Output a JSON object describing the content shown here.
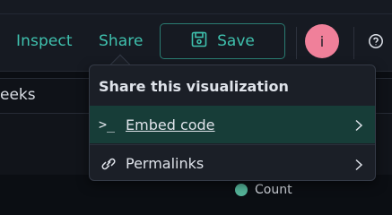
{
  "header": {
    "inspect_label": "Inspect",
    "share_label": "Share",
    "save_label": "Save",
    "avatar_initial": "i"
  },
  "query": {
    "value_text": "eeks"
  },
  "share_popover": {
    "title": "Share this visualization",
    "items": [
      {
        "label": "Embed code",
        "icon": "terminal-icon",
        "state": "highlighted"
      },
      {
        "label": "Permalinks",
        "icon": "link-icon",
        "state": "normal"
      }
    ]
  },
  "legend": {
    "series_label": "Count",
    "series_color": "#54b399"
  },
  "colors": {
    "accent": "#3fc1ae",
    "avatar": "#f0809a",
    "highlight_row": "#173d38"
  }
}
